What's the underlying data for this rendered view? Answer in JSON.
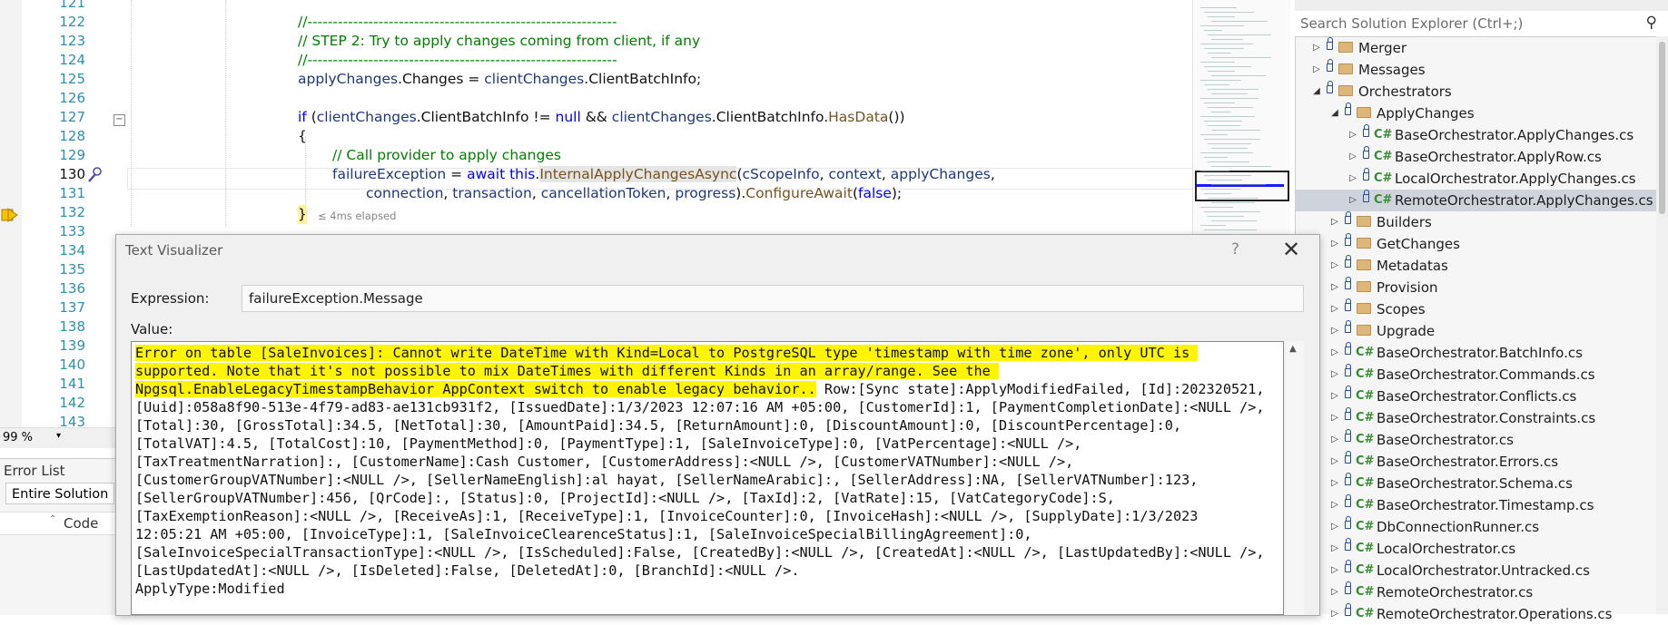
{
  "editor": {
    "line_numbers": [
      "121",
      "122",
      "123",
      "124",
      "125",
      "126",
      "127",
      "128",
      "129",
      "130",
      "131",
      "132",
      "133",
      "134",
      "135",
      "136",
      "137",
      "138",
      "139",
      "140",
      "141",
      "142",
      "143"
    ],
    "current_line": "130",
    "code": {
      "l122": "//-------------------------------------------------------------",
      "l123": "// STEP 2: Try to apply changes coming from client, if any",
      "l124": "//-------------------------------------------------------------",
      "l125": {
        "a": "applyChanges",
        "b": ".Changes = ",
        "c": "clientChanges",
        "d": ".ClientBatchInfo;"
      },
      "l127": {
        "kw": "if",
        "b": " (",
        "c": "clientChanges",
        "d": ".ClientBatchInfo != ",
        "e": "null",
        "f": " && ",
        "g": "clientChanges",
        "h": ".ClientBatchInfo.",
        "i": "HasData",
        "j": "())"
      },
      "l128": "{",
      "l129": "// Call provider to apply changes",
      "l130": {
        "a": "failureException",
        "b": " = ",
        "c": "await",
        "d": " ",
        "e": "this",
        "f": ".",
        "g": "InternalApplyChangesAsync",
        "h": "(",
        "i": "cScopeInfo",
        ", ": ", ",
        "j": "context",
        "k": ", ",
        "l": "applyChanges",
        "m": ","
      },
      "l131": {
        "a": "connection",
        "b": ", ",
        "c": "transaction",
        "d": ", ",
        "e": "cancellationToken",
        "f": ", ",
        "g": "progress",
        "h": ").",
        "i": "ConfigureAwait",
        "j": "(",
        "k": "false",
        "l": ");"
      },
      "l132": "}",
      "elapsed": "≤ 4ms elapsed"
    },
    "zoom": "99 %"
  },
  "error_list": {
    "title": "Error List",
    "scope": "Entire Solution",
    "col_code": "Code"
  },
  "solution_explorer": {
    "search_placeholder": "Search Solution Explorer (Ctrl+;)",
    "items": [
      {
        "label": "Merger",
        "type": "folder",
        "expanded": false
      },
      {
        "label": "Messages",
        "type": "folder",
        "expanded": false
      },
      {
        "label": "Orchestrators",
        "type": "folder",
        "expanded": true
      },
      {
        "label": "ApplyChanges",
        "type": "folder",
        "expanded": true
      },
      {
        "label": "BaseOrchestrator.ApplyChanges.cs",
        "type": "cs"
      },
      {
        "label": "BaseOrchestrator.ApplyRow.cs",
        "type": "cs"
      },
      {
        "label": "LocalOrchestrator.ApplyChanges.cs",
        "type": "cs"
      },
      {
        "label": "RemoteOrchestrator.ApplyChanges.cs",
        "type": "cs",
        "selected": true
      },
      {
        "label": "Builders",
        "type": "folder"
      },
      {
        "label": "GetChanges",
        "type": "folder"
      },
      {
        "label": "Metadatas",
        "type": "folder"
      },
      {
        "label": "Provision",
        "type": "folder"
      },
      {
        "label": "Scopes",
        "type": "folder"
      },
      {
        "label": "Upgrade",
        "type": "folder"
      },
      {
        "label": "BaseOrchestrator.BatchInfo.cs",
        "type": "cs"
      },
      {
        "label": "BaseOrchestrator.Commands.cs",
        "type": "cs"
      },
      {
        "label": "BaseOrchestrator.Conflicts.cs",
        "type": "cs"
      },
      {
        "label": "BaseOrchestrator.Constraints.cs",
        "type": "cs"
      },
      {
        "label": "BaseOrchestrator.cs",
        "type": "cs"
      },
      {
        "label": "BaseOrchestrator.Errors.cs",
        "type": "cs"
      },
      {
        "label": "BaseOrchestrator.Schema.cs",
        "type": "cs"
      },
      {
        "label": "BaseOrchestrator.Timestamp.cs",
        "type": "cs"
      },
      {
        "label": "DbConnectionRunner.cs",
        "type": "cs"
      },
      {
        "label": "LocalOrchestrator.cs",
        "type": "cs"
      },
      {
        "label": "LocalOrchestrator.Untracked.cs",
        "type": "cs"
      },
      {
        "label": "RemoteOrchestrator.cs",
        "type": "cs"
      },
      {
        "label": "RemoteOrchestrator.Operations.cs",
        "type": "cs"
      }
    ],
    "cs_badge": "C#"
  },
  "dialog": {
    "title": "Text Visualizer",
    "help": "?",
    "close": "✕",
    "expression_label": "Expression:",
    "expression_value": "failureException.Message",
    "value_label": "Value:",
    "value_highlighted": "Error on table [SaleInvoices]: Cannot write DateTime with Kind=Local to PostgreSQL type 'timestamp with time zone', only UTC is supported. Note that it's not possible to mix DateTimes with different Kinds in an array/range. See the Npgsql.EnableLegacyTimestampBehavior AppContext switch to enable legacy behavior..",
    "value_rest": " Row:[Sync state]:ApplyModifiedFailed, [Id]:202320521, [Uuid]:058a8f90-513e-4f79-ad83-ae131cb931f2, [IssuedDate]:1/3/2023 12:07:16 AM +05:00, [CustomerId]:1, [PaymentCompletionDate]:<NULL />, [Total]:30, [GrossTotal]:34.5, [NetTotal]:30, [AmountPaid]:34.5, [ReturnAmount]:0, [DiscountAmount]:0, [DiscountPercentage]:0, [TotalVAT]:4.5, [TotalCost]:10, [PaymentMethod]:0, [PaymentType]:1, [SaleInvoiceType]:0, [VatPercentage]:<NULL />, [TaxTreatmentNarration]:, [CustomerName]:Cash Customer, [CustomerAddress]:<NULL />, [CustomerVATNumber]:<NULL />, [CustomerGroupVATNumber]:<NULL />, [SellerNameEnglish]:al hayat, [SellerNameArabic]:, [SellerAddress]:NA, [SellerVATNumber]:123, [SellerGroupVATNumber]:456, [QrCode]:, [Status]:0, [ProjectId]:<NULL />, [TaxId]:2, [VatRate]:15, [VatCategoryCode]:S, [TaxExemptionReason]:<NULL />, [ReceiveAs]:1, [ReceiveType]:1, [InvoiceCounter]:0, [InvoiceHash]:<NULL />, [SupplyDate]:1/3/2023 12:05:21 AM +05:00, [InvoiceType]:1, [SaleInvoiceClearenceStatus]:1, [SaleInvoiceSpecialBillingAgreement]:0, [SaleInvoiceSpecialTransactionType]:<NULL />, [IsScheduled]:False, [CreatedBy]:<NULL />, [CreatedAt]:<NULL />, [LastUpdatedBy]:<NULL />, [LastUpdatedAt]:<NULL />, [IsDeleted]:False, [DeletedAt]:0, [BranchId]:<NULL />.\nApplyType:Modified"
  }
}
